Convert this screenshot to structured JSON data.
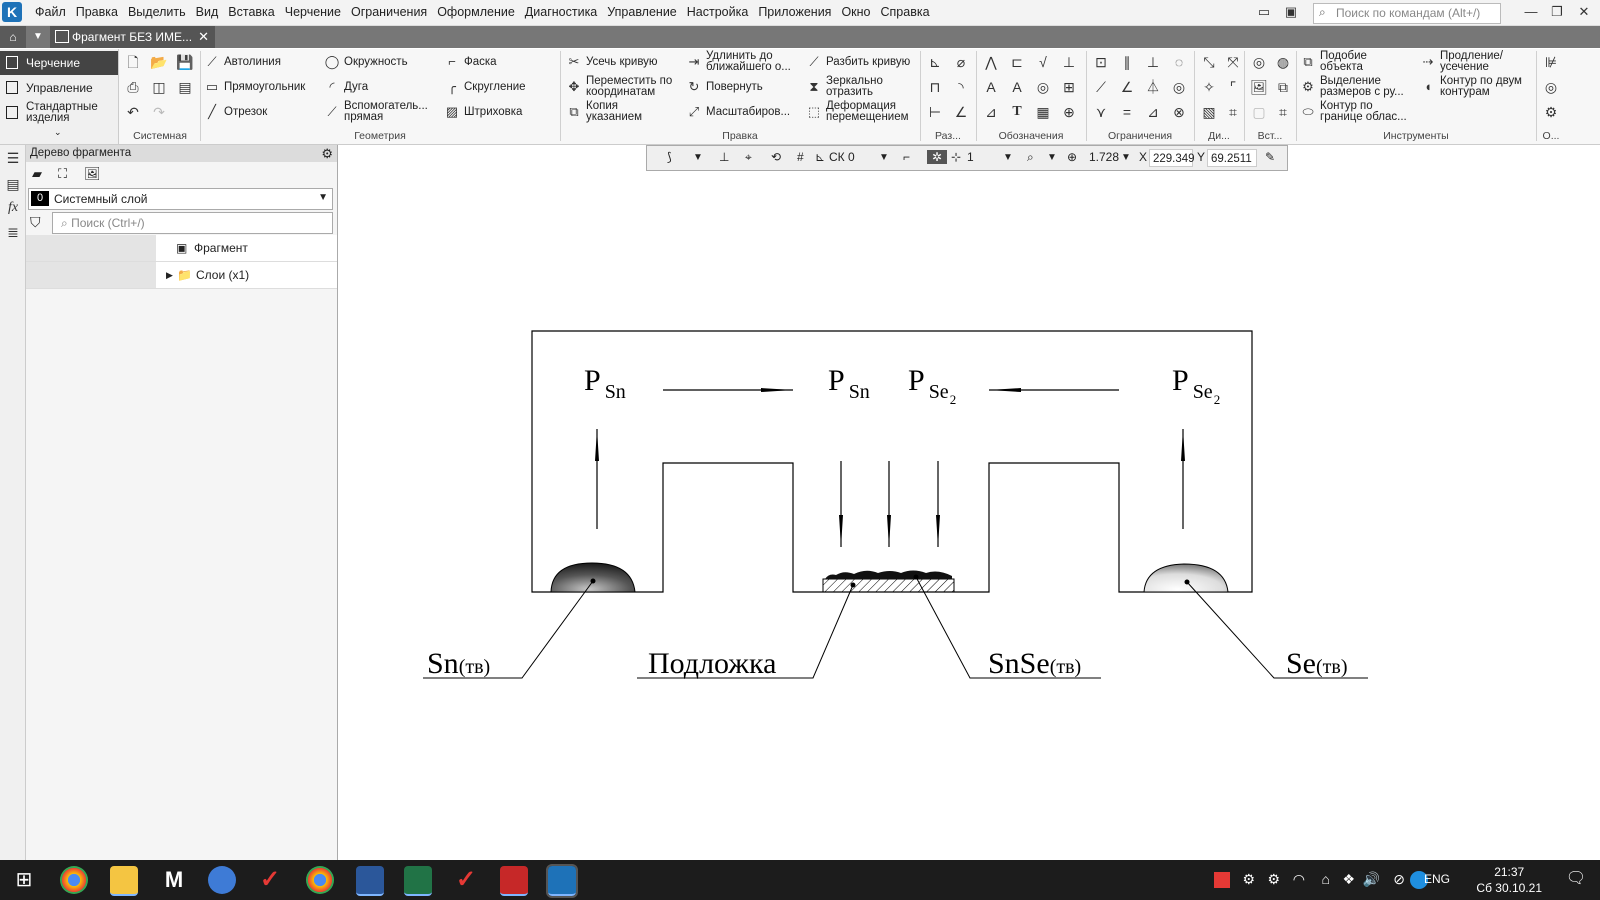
{
  "menu": [
    "Файл",
    "Правка",
    "Выделить",
    "Вид",
    "Вставка",
    "Черчение",
    "Ограничения",
    "Оформление",
    "Диагностика",
    "Управление",
    "Настройка",
    "Приложения",
    "Окно",
    "Справка"
  ],
  "search_placeholder": "Поиск по командам (Alt+/)",
  "doc_tab": "Фрагмент БЕЗ ИМЕ...",
  "modes": {
    "drawing": "Черчение",
    "control": "Управление",
    "standard": "Стандартные изделия"
  },
  "ribbon": {
    "autoline": "Автолиния",
    "rectangle": "Прямоугольник",
    "segment": "Отрезок",
    "circle": "Окружность",
    "arc": "Дуга",
    "aux_line": "Вспомогатель... прямая",
    "chamfer": "Фаска",
    "fillet": "Скругление",
    "hatch": "Штриховка",
    "trim": "Усечь кривую",
    "move_coords": "Переместить по координатам",
    "copy": "Копия указанием",
    "extend": "Удлинить до ближайшего о...",
    "rotate": "Повернуть",
    "scale": "Масштабиров...",
    "split": "Разбить кривую",
    "mirror": "Зеркально отразить",
    "deform": "Деформация перемещением",
    "similar": "Подобие объекта",
    "select_dims": "Выделение размеров с ру...",
    "contour_border": "Контур по границе облас...",
    "extend_trim": "Продление/ усечение",
    "contour_two": "Контур по двум контурам",
    "groups": {
      "system": "Системная",
      "geometry": "Геометрия",
      "edit": "Правка",
      "raz": "Раз...",
      "notation": "Обозначения",
      "constraints": "Ограничения",
      "di": "Ди...",
      "vst": "Вст...",
      "tools": "Инструменты",
      "o": "О..."
    }
  },
  "tree": {
    "title": "Дерево фрагмента",
    "layer_num": "0",
    "layer": "Системный слой",
    "search_placeholder": "Поиск (Ctrl+/)",
    "items": [
      "Фрагмент",
      "Слои (x1)"
    ]
  },
  "snapbar": {
    "cs": "СК 0",
    "step": "1",
    "zoom": "1.728",
    "x_label": "X",
    "x_value": "229.349",
    "y_label": "Y",
    "y_value": "69.2511"
  },
  "diagram": {
    "p": "P",
    "sub_sn": "Sn",
    "sub_se": "Se",
    "sub_2": "2",
    "sn_main": "Sn",
    "sn_sub": "(тв)",
    "substrate": "Подложка",
    "snse_main": "SnSe",
    "snse_sub": "(тв)",
    "se_main": "Se",
    "se_sub": "(тв)"
  },
  "taskbar": {
    "lang": "ENG",
    "time": "21:37",
    "date": "Сб 30.10.21"
  }
}
